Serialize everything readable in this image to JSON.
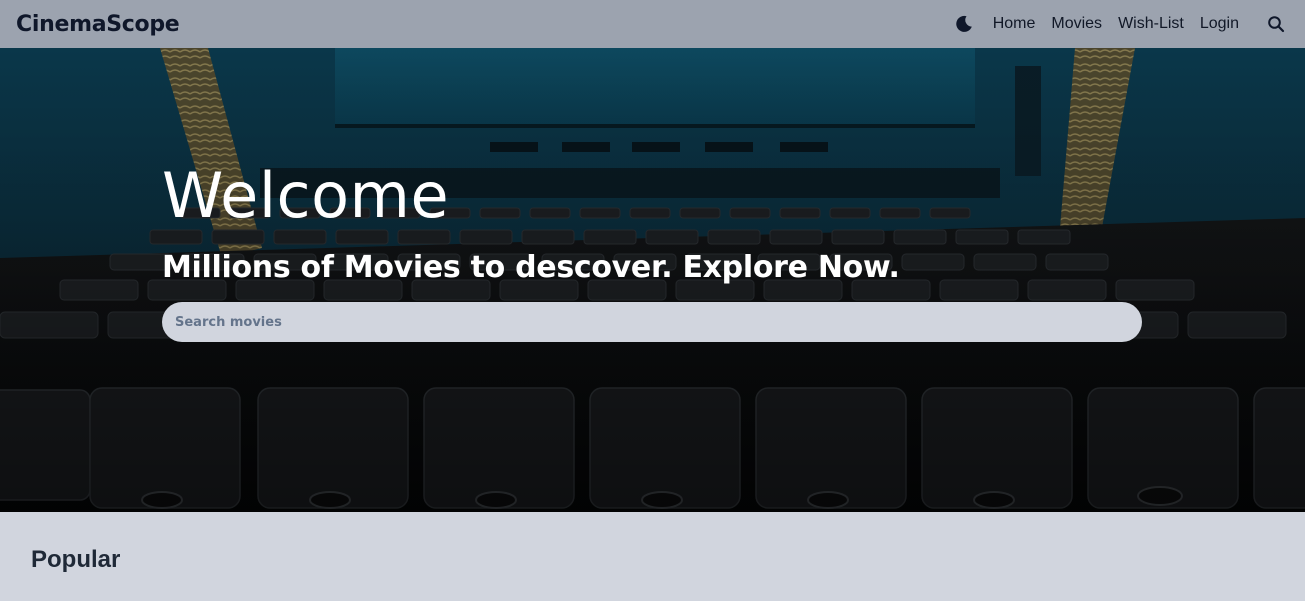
{
  "navbar": {
    "brand": "CinemaScope",
    "theme_icon": "moon-icon",
    "links": [
      {
        "label": "Home"
      },
      {
        "label": "Movies"
      },
      {
        "label": "Wish-List"
      },
      {
        "label": "Login"
      }
    ],
    "search_icon": "search-icon"
  },
  "hero": {
    "title": "Welcome",
    "subtitle": "Millions of Movies to descover. Explore Now.",
    "search_placeholder": "Search movies"
  },
  "popular": {
    "title": "Popular"
  },
  "colors": {
    "navbar_bg": "#9ca3af",
    "page_bg": "#d1d5de",
    "search_bg": "#d1d5de"
  }
}
